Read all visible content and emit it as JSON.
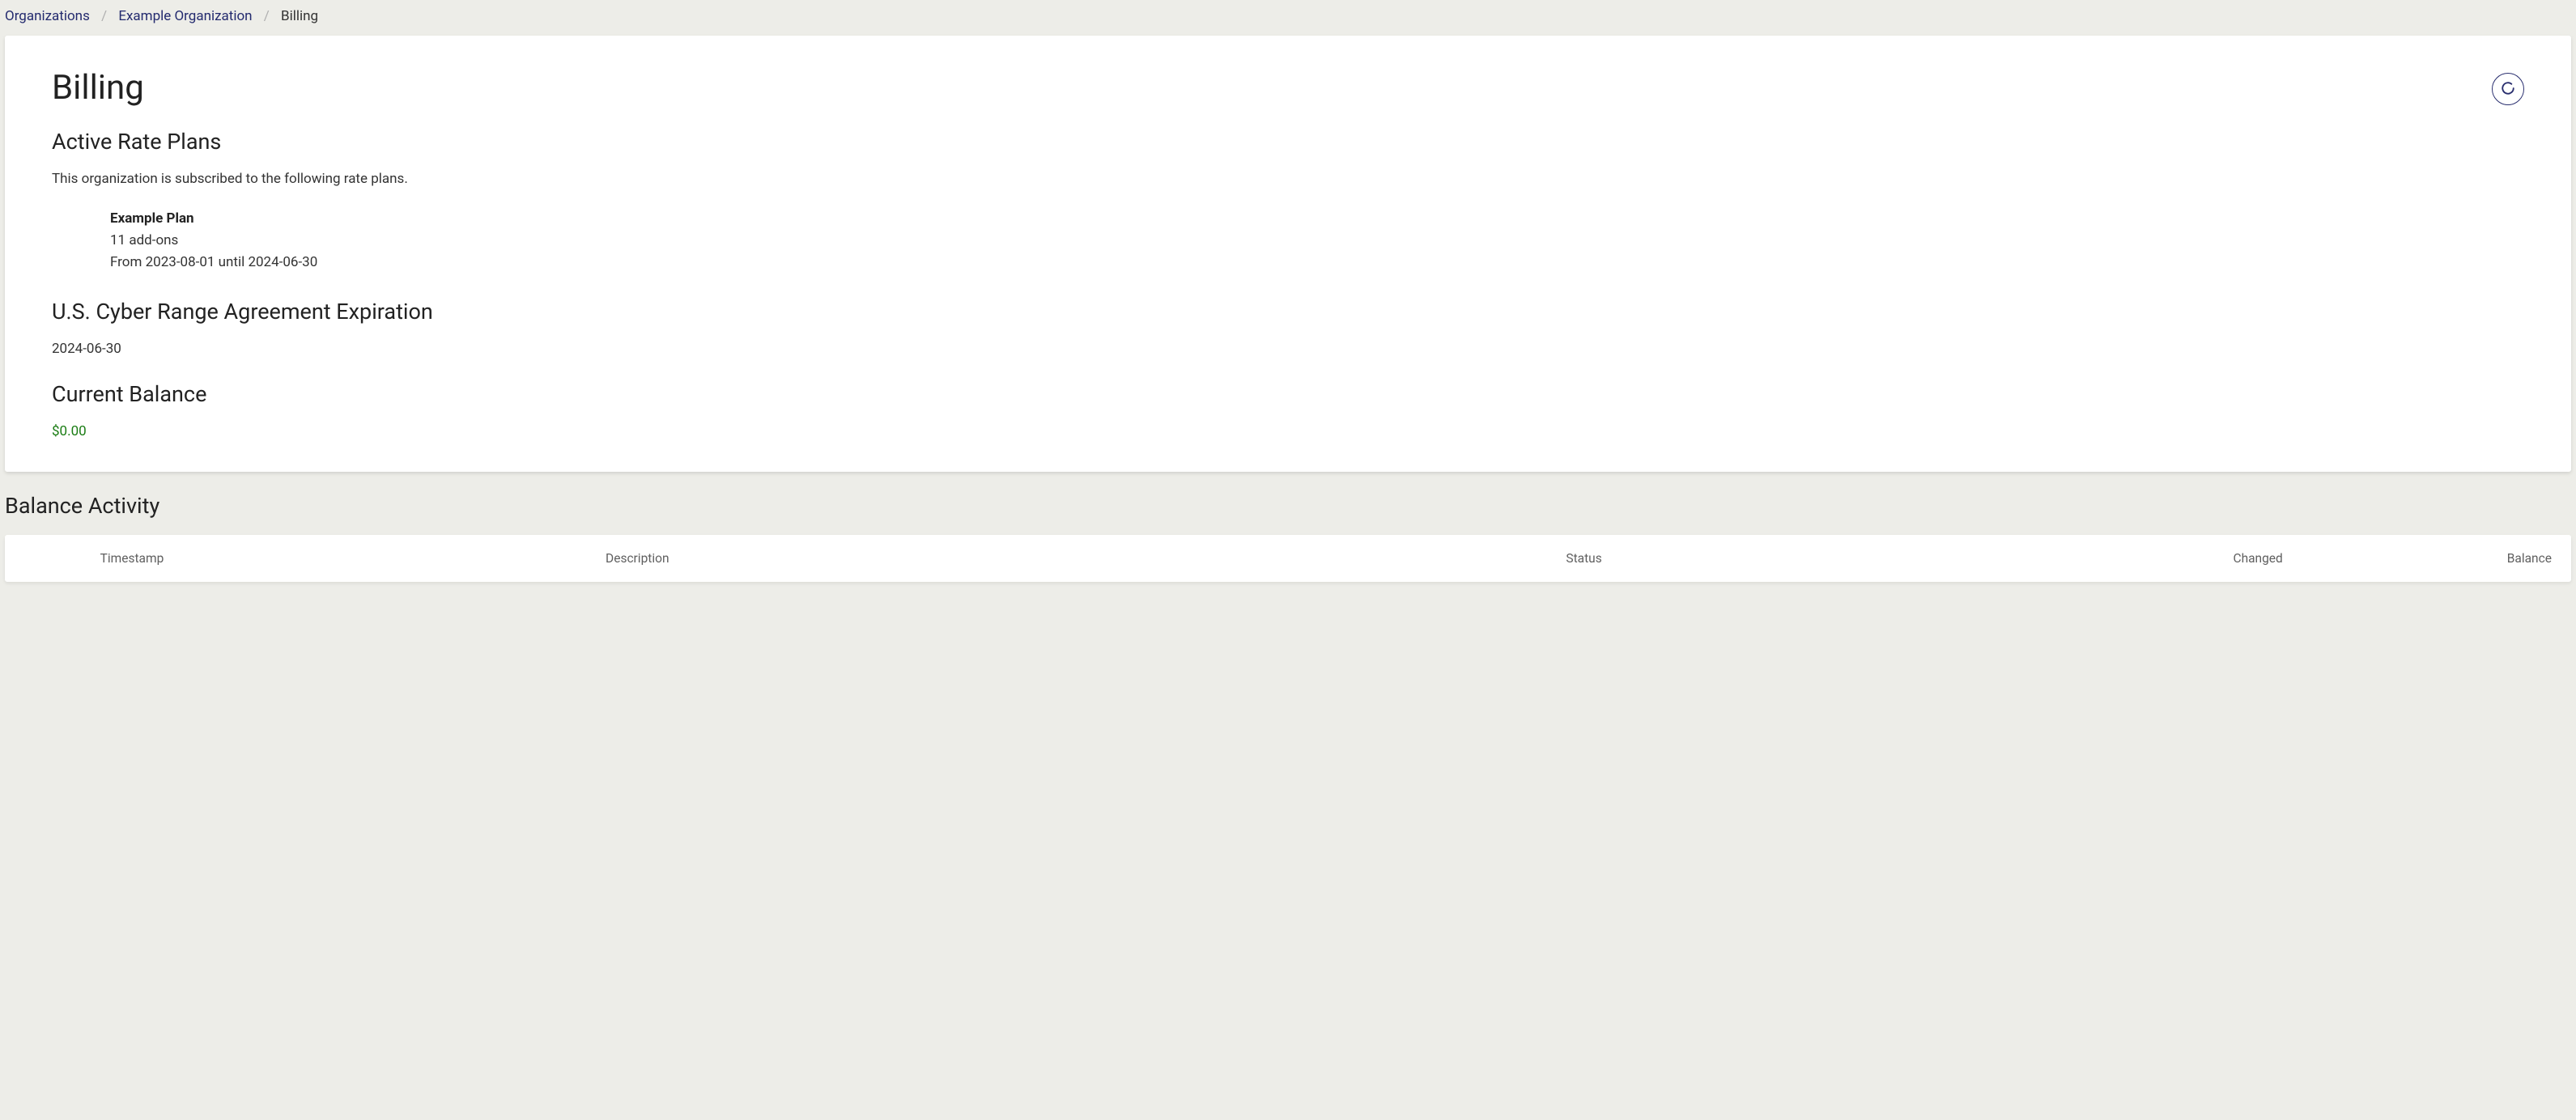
{
  "breadcrumb": {
    "root": "Organizations",
    "org": "Example Organization",
    "current": "Billing"
  },
  "page": {
    "title": "Billing"
  },
  "active_plans": {
    "heading": "Active Rate Plans",
    "subtext": "This organization is subscribed to the following rate plans.",
    "plan": {
      "name": "Example Plan",
      "addons": "11 add-ons",
      "period": "From 2023-08-01 until 2024-06-30"
    }
  },
  "agreement": {
    "heading": "U.S. Cyber Range Agreement Expiration",
    "date": "2024-06-30"
  },
  "balance": {
    "heading": "Current Balance",
    "value": "$0.00"
  },
  "activity": {
    "heading": "Balance Activity",
    "columns": {
      "timestamp": "Timestamp",
      "description": "Description",
      "status": "Status",
      "changed": "Changed",
      "balance": "Balance"
    }
  },
  "icons": {
    "refresh": "refresh"
  }
}
